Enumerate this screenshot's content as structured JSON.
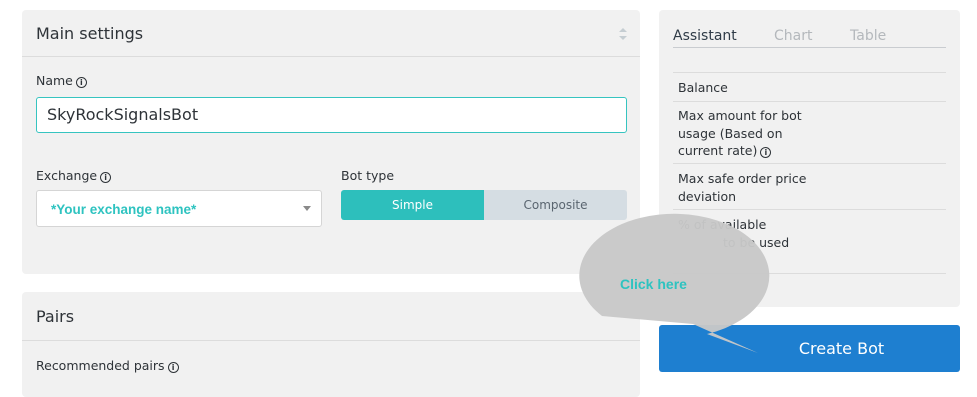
{
  "main_settings": {
    "title": "Main settings",
    "name_label": "Name",
    "name_value": "SkyRockSignalsBot",
    "exchange_label": "Exchange",
    "exchange_value": "*Your exchange name*",
    "bot_type_label": "Bot type",
    "bot_type_options": [
      "Simple",
      "Composite"
    ],
    "bot_type_selected": "Simple"
  },
  "pairs": {
    "title": "Pairs",
    "recommended_label": "Recommended pairs"
  },
  "assistant": {
    "tabs": [
      "Assistant",
      "Chart",
      "Table"
    ],
    "active_tab": "Assistant",
    "rows": [
      "Balance",
      "Max amount for bot usage (Based on current rate)",
      "Max safe order price deviation",
      "% of available",
      "to be used"
    ]
  },
  "create_button": "Create Bot",
  "callout": "Click here",
  "colors": {
    "accent_teal": "#2dbfbc",
    "primary_blue": "#1e7fd0",
    "panel_bg": "#f1f1f1",
    "callout_bubble": "#c8c8c8"
  },
  "icons": [
    "info-icon",
    "collapse-icon",
    "chevron-down-icon"
  ]
}
